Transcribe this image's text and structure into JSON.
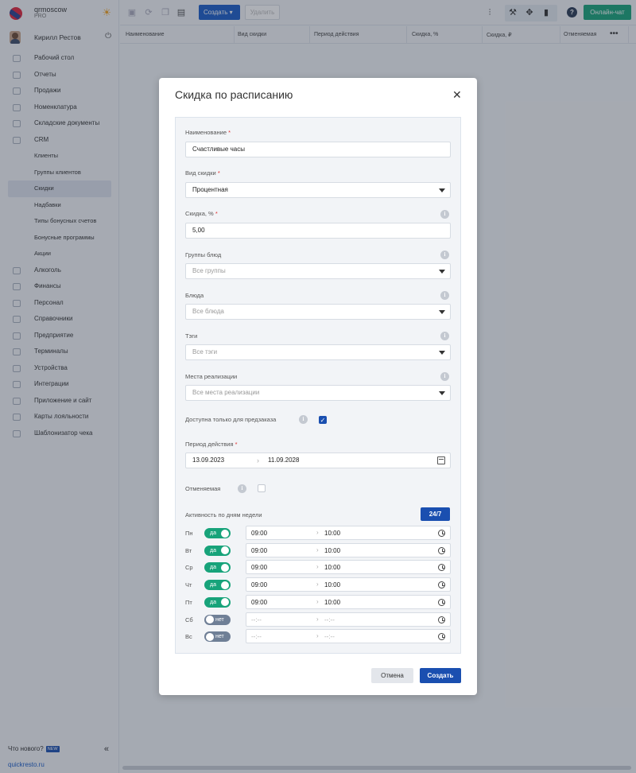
{
  "brand": {
    "name": "qrmoscow",
    "plan": "PRO"
  },
  "user": {
    "name": "Кирилл Рестов"
  },
  "nav": [
    {
      "label": "Рабочий стол",
      "sub": false,
      "active": false
    },
    {
      "label": "Отчеты",
      "sub": false,
      "active": false
    },
    {
      "label": "Продажи",
      "sub": false,
      "active": false
    },
    {
      "label": "Номенклатура",
      "sub": false,
      "active": false
    },
    {
      "label": "Складские документы",
      "sub": false,
      "active": false
    },
    {
      "label": "CRM",
      "sub": false,
      "active": false
    },
    {
      "label": "Клиенты",
      "sub": true,
      "active": false
    },
    {
      "label": "Группы клиентов",
      "sub": true,
      "active": false
    },
    {
      "label": "Скидки",
      "sub": true,
      "active": true
    },
    {
      "label": "Надбавки",
      "sub": true,
      "active": false
    },
    {
      "label": "Типы бонусных счетов",
      "sub": true,
      "active": false
    },
    {
      "label": "Бонусные программы",
      "sub": true,
      "active": false
    },
    {
      "label": "Акции",
      "sub": true,
      "active": false
    },
    {
      "label": "Алкоголь",
      "sub": false,
      "active": false
    },
    {
      "label": "Финансы",
      "sub": false,
      "active": false
    },
    {
      "label": "Персонал",
      "sub": false,
      "active": false
    },
    {
      "label": "Справочники",
      "sub": false,
      "active": false
    },
    {
      "label": "Предприятие",
      "sub": false,
      "active": false
    },
    {
      "label": "Терминалы",
      "sub": false,
      "active": false
    },
    {
      "label": "Устройства",
      "sub": false,
      "active": false
    },
    {
      "label": "Интеграции",
      "sub": false,
      "active": false
    },
    {
      "label": "Приложение и сайт",
      "sub": false,
      "active": false
    },
    {
      "label": "Карты лояльности",
      "sub": false,
      "active": false
    },
    {
      "label": "Шаблонизатор чека",
      "sub": false,
      "active": false
    }
  ],
  "sidebar_footer": {
    "whats_new": "Что нового?",
    "new_badge": "NEW",
    "link": "quickresto.ru"
  },
  "toolbar": {
    "create_label": "Создать",
    "delete_label": "Удалить",
    "chat_label": "Онлайн-чат",
    "help": "?"
  },
  "table": {
    "columns": [
      "Наименование",
      "Вид скидки",
      "Период действия",
      "Скидка, %",
      "Скидка, ₽",
      "Отменяемая"
    ]
  },
  "modal": {
    "title": "Скидка по расписанию",
    "name": {
      "label": "Наименование",
      "value": "Счастливые часы"
    },
    "kind": {
      "label": "Вид скидки",
      "value": "Процентная"
    },
    "discount": {
      "label": "Скидка, %",
      "value": "5,00"
    },
    "dish_groups": {
      "label": "Группы блюд",
      "placeholder": "Все группы"
    },
    "dishes": {
      "label": "Блюда",
      "placeholder": "Все блюда"
    },
    "tags": {
      "label": "Тэги",
      "placeholder": "Все тэги"
    },
    "places": {
      "label": "Места реализации",
      "placeholder": "Все места реализации"
    },
    "preorder": {
      "label": "Доступна только для предзаказа",
      "checked": true
    },
    "period": {
      "label": "Период действия",
      "from": "13.09.2023",
      "to": "11.09.2028"
    },
    "cancelable": {
      "label": "Отменяемая",
      "checked": false
    },
    "weekly": {
      "label": "Активность по дням недели",
      "button": "24/7"
    },
    "days": [
      {
        "day": "Пн",
        "toggle": "да",
        "on": true,
        "from": "09:00",
        "to": "10:00"
      },
      {
        "day": "Вт",
        "toggle": "да",
        "on": true,
        "from": "09:00",
        "to": "10:00"
      },
      {
        "day": "Ср",
        "toggle": "да",
        "on": true,
        "from": "09:00",
        "to": "10:00"
      },
      {
        "day": "Чт",
        "toggle": "да",
        "on": true,
        "from": "09:00",
        "to": "10:00"
      },
      {
        "day": "Пт",
        "toggle": "да",
        "on": true,
        "from": "09:00",
        "to": "10:00"
      },
      {
        "day": "Сб",
        "toggle": "нет",
        "on": false,
        "from": "--:--",
        "to": "--:--"
      },
      {
        "day": "Вс",
        "toggle": "нет",
        "on": false,
        "from": "--:--",
        "to": "--:--"
      }
    ],
    "cancel_label": "Отмена",
    "submit_label": "Создать"
  },
  "colors": {
    "accent": "#1a4fb0",
    "green": "#17a37a",
    "required": "#e03030"
  }
}
